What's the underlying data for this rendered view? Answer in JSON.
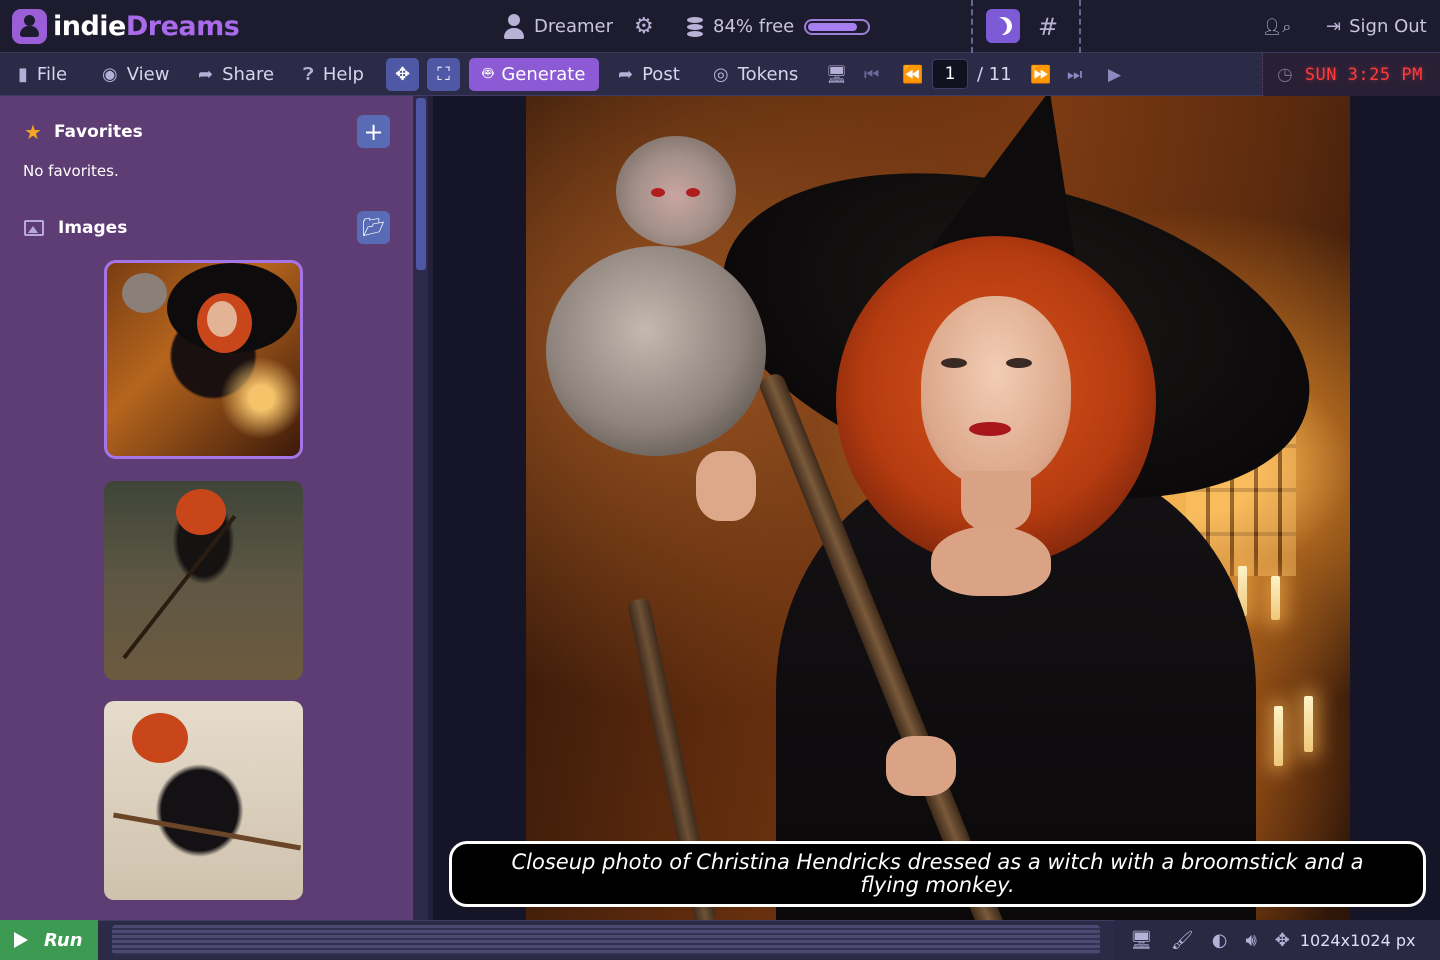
{
  "app": {
    "logo_part1": "indie",
    "logo_part2": "Dreams",
    "brand_color": "#a96bea"
  },
  "topbar": {
    "user_name": "Dreamer",
    "storage_label": "84% free",
    "storage_free_fraction": 0.84,
    "theme_icon": "moon-icon",
    "hash_label": "#",
    "sign_out_label": "Sign Out"
  },
  "menubar": {
    "file": "File",
    "view": "View",
    "share": "Share",
    "help": "Help",
    "generate": "Generate",
    "post": "Post",
    "tokens": "Tokens",
    "page_current": "1",
    "page_total": "/ 11",
    "clock": "SUN 3:25 PM"
  },
  "sidebar": {
    "favorites_title": "Favorites",
    "favorites_empty": "No favorites.",
    "images_title": "Images",
    "thumbnails": [
      {
        "selected": true
      },
      {
        "selected": false
      },
      {
        "selected": false
      }
    ]
  },
  "viewer": {
    "caption": "Closeup photo of Christina Hendricks dressed as a witch with a broomstick and a flying monkey."
  },
  "bottombar": {
    "run_label": "Run",
    "resolution": "1024x1024 px"
  },
  "colors": {
    "accent": "#8c5ad4",
    "sidebar_bg": "#5e3d75",
    "run_green": "#3d9a53",
    "clock_red": "#ff3b3b"
  }
}
